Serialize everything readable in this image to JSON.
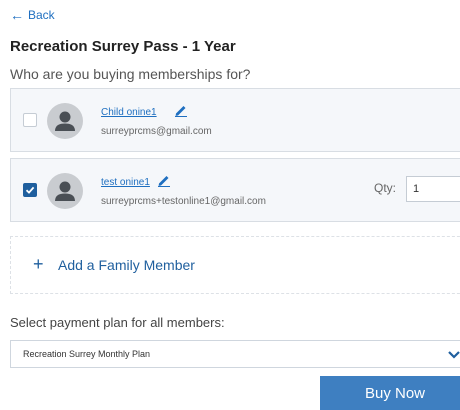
{
  "nav": {
    "back_label": "Back",
    "back_icon": "arrow-left-icon"
  },
  "header": {
    "title": "Recreation Surrey Pass - 1 Year",
    "subtitle": "Who are you buying memberships for?"
  },
  "members": [
    {
      "name": "Child onine1",
      "email": "surreyprcms@gmail.com",
      "checked": false
    },
    {
      "name": "test onine1",
      "email": "surreyprcms+testonline1@gmail.com",
      "checked": true,
      "qty_label": "Qty:",
      "qty_value": "1"
    }
  ],
  "add_member": {
    "label": "Add a Family Member",
    "icon": "plus-icon"
  },
  "payment": {
    "label": "Select payment plan for all members:",
    "selected": "Recreation Surrey Monthly Plan"
  },
  "actions": {
    "buy_now_label": "Buy Now"
  },
  "colors": {
    "link": "#1f6fc0",
    "primary": "#1f5f9e",
    "button": "#3e7fc1",
    "card_bg": "#f5f7fa",
    "border": "#d8dde3"
  }
}
